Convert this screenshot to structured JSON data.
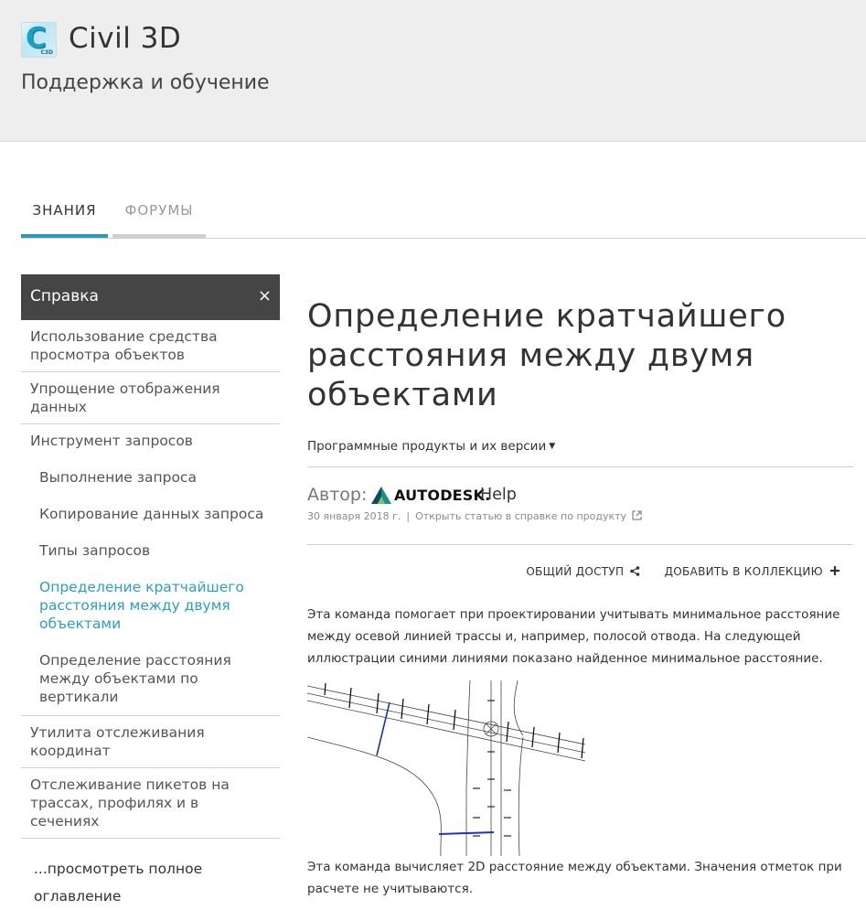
{
  "header": {
    "product": "Civil 3D",
    "logo_letter": "C",
    "logo_sub": "C3D",
    "support": "Поддержка и обучение"
  },
  "tabs": [
    {
      "label": "ЗНАНИЯ",
      "active": true
    },
    {
      "label": "ФОРУМЫ",
      "active": false
    }
  ],
  "sidebar": {
    "title": "Справка",
    "close_glyph": "×",
    "items": [
      {
        "label": "Использование средства просмотра объектов"
      },
      {
        "label": "Упрощение отображения данных"
      },
      {
        "label": "Инструмент запросов"
      },
      {
        "label": "Выполнение запроса"
      },
      {
        "label": "Копирование данных запроса"
      },
      {
        "label": "Типы запросов"
      },
      {
        "label": "Определение кратчайшего расстояния между двумя объектами"
      },
      {
        "label": "Определение расстояния между объектами по вертикали"
      },
      {
        "label": "Утилита отслеживания координат"
      },
      {
        "label": "Отслеживание пикетов на трассах, профилях и в сечениях"
      }
    ],
    "full_toc": "...просмотреть полное оглавление"
  },
  "article": {
    "title": "Определение кратчайшего расстояния между двумя объектами",
    "products_label": "Программные продукты и их версии",
    "author_label": "Автор:",
    "brand": "AUTODESK.",
    "brand_suffix": "Help",
    "date": "30 января 2018 г.",
    "separator": "|",
    "open_link": "Открыть статью в справке по продукту",
    "share": "ОБЩИЙ ДОСТУП",
    "add_collection": "ДОБАВИТЬ В КОЛЛЕКЦИЮ",
    "paragraph1": "Эта команда помогает при проектировании учитывать минимальное расстояние между осевой линией трассы и, например, полосой отвода. На следующей иллюстрации синими линиями показано найденное минимальное расстояние.",
    "paragraph2": "Эта команда вычисляет 2D расстояние между объектами. Значения отметок при расчете не учитываются."
  },
  "colors": {
    "accent": "#2b9bbd",
    "link_current": "#2aa0c0",
    "sidebar_header_bg": "#454545",
    "header_bg": "#eeeeee",
    "measure_line": "#1a35b5"
  },
  "icons": [
    "close-icon",
    "caret-down-icon",
    "share-icon",
    "plus-icon",
    "external-link-icon",
    "autodesk-logo-icon"
  ]
}
